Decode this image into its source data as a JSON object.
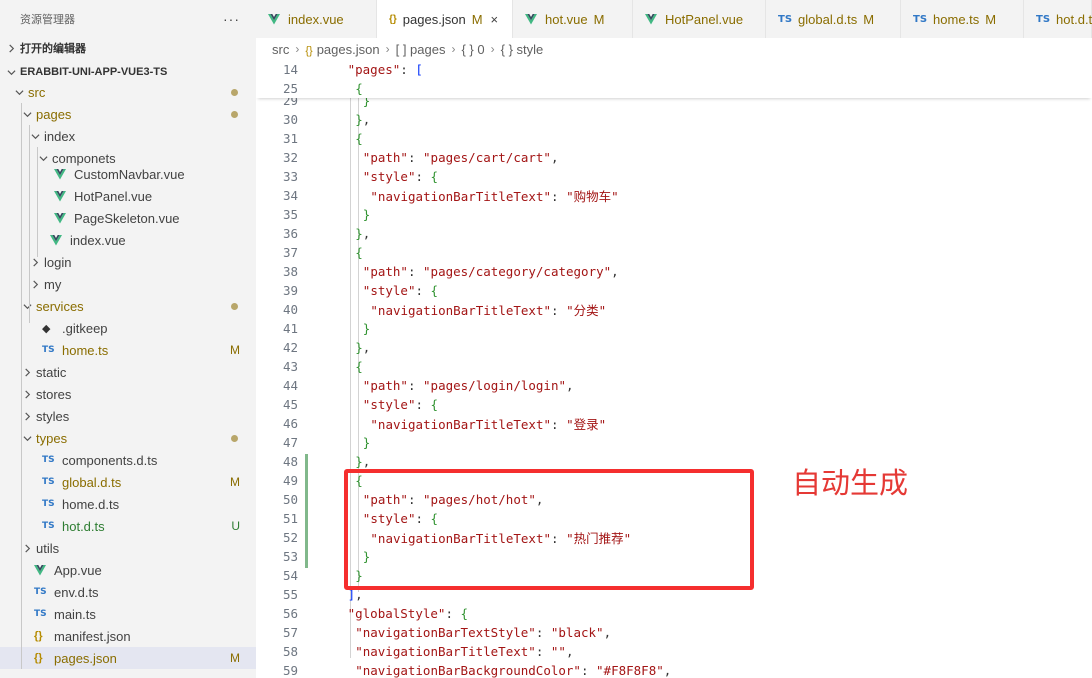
{
  "explorer": {
    "title": "资源管理器",
    "more": "···",
    "open_editors": "打开的编辑器",
    "project": "ERABBIT-UNI-APP-VUE3-TS",
    "rows": [
      {
        "label": "src",
        "kind": "folder",
        "open": true,
        "depth": 0,
        "status": "dot",
        "style": "folder-mod"
      },
      {
        "label": "pages",
        "kind": "folder",
        "open": true,
        "depth": 1,
        "status": "dot",
        "style": "folder-mod"
      },
      {
        "label": "index",
        "kind": "folder",
        "open": true,
        "depth": 2,
        "status": "",
        "style": ""
      },
      {
        "label": "componets",
        "kind": "folder",
        "open": true,
        "depth": 3,
        "status": "",
        "style": ""
      },
      {
        "label": "CustomNavbar.vue",
        "kind": "vue",
        "depth": 4,
        "status": "",
        "style": ""
      },
      {
        "label": "HotPanel.vue",
        "kind": "vue",
        "depth": 4,
        "status": "",
        "style": ""
      },
      {
        "label": "PageSkeleton.vue",
        "kind": "vue",
        "depth": 4,
        "status": "",
        "style": ""
      },
      {
        "label": "index.vue",
        "kind": "vue",
        "depth": 3,
        "status": "",
        "style": ""
      },
      {
        "label": "login",
        "kind": "folder",
        "open": false,
        "depth": 2,
        "status": "",
        "style": ""
      },
      {
        "label": "my",
        "kind": "folder",
        "open": false,
        "depth": 2,
        "status": "",
        "style": ""
      },
      {
        "label": "services",
        "kind": "folder",
        "open": true,
        "depth": 1,
        "status": "dot",
        "style": "folder-mod"
      },
      {
        "label": ".gitkeep",
        "kind": "git",
        "depth": 2,
        "status": "",
        "style": ""
      },
      {
        "label": "home.ts",
        "kind": "ts",
        "depth": 2,
        "status": "M",
        "style": "mod"
      },
      {
        "label": "static",
        "kind": "folder",
        "open": false,
        "depth": 1,
        "status": "",
        "style": ""
      },
      {
        "label": "stores",
        "kind": "folder",
        "open": false,
        "depth": 1,
        "status": "",
        "style": ""
      },
      {
        "label": "styles",
        "kind": "folder",
        "open": false,
        "depth": 1,
        "status": "",
        "style": ""
      },
      {
        "label": "types",
        "kind": "folder",
        "open": true,
        "depth": 1,
        "status": "dot",
        "style": "folder-mod"
      },
      {
        "label": "components.d.ts",
        "kind": "ts",
        "depth": 2,
        "status": "",
        "style": ""
      },
      {
        "label": "global.d.ts",
        "kind": "ts",
        "depth": 2,
        "status": "M",
        "style": "mod"
      },
      {
        "label": "home.d.ts",
        "kind": "ts",
        "depth": 2,
        "status": "",
        "style": ""
      },
      {
        "label": "hot.d.ts",
        "kind": "ts",
        "depth": 2,
        "status": "U",
        "style": "untracked"
      },
      {
        "label": "utils",
        "kind": "folder",
        "open": false,
        "depth": 1,
        "status": "",
        "style": ""
      },
      {
        "label": "App.vue",
        "kind": "vue",
        "depth": 1,
        "status": "",
        "style": ""
      },
      {
        "label": "env.d.ts",
        "kind": "ts",
        "depth": 1,
        "status": "",
        "style": ""
      },
      {
        "label": "main.ts",
        "kind": "ts",
        "depth": 1,
        "status": "",
        "style": ""
      },
      {
        "label": "manifest.json",
        "kind": "json",
        "depth": 1,
        "status": "",
        "style": ""
      },
      {
        "label": "pages.json",
        "kind": "json",
        "depth": 1,
        "status": "M",
        "style": "mod",
        "selected": true
      }
    ]
  },
  "tabs": [
    {
      "label": "index.vue",
      "icon": "vue",
      "status": "",
      "active": false
    },
    {
      "label": "pages.json",
      "icon": "json",
      "status": "M",
      "active": true
    },
    {
      "label": "hot.vue",
      "icon": "vue",
      "status": "M",
      "active": false
    },
    {
      "label": "HotPanel.vue",
      "icon": "vue",
      "status": "",
      "active": false
    },
    {
      "label": "global.d.ts",
      "icon": "ts",
      "status": "M",
      "active": false
    },
    {
      "label": "home.ts",
      "icon": "ts",
      "status": "M",
      "active": false
    },
    {
      "label": "hot.d.ts",
      "icon": "ts",
      "status": "",
      "active": false
    }
  ],
  "breadcrumb": [
    "src",
    "pages.json",
    "[ ] pages",
    "{ } 0",
    "{ } style"
  ],
  "icons": {
    "json": "{}",
    "ts": "TS",
    "close": "×",
    "chevron_right": "chevron-right-icon",
    "chevron_down": "chevron-down-icon"
  },
  "code": {
    "sticky": [
      {
        "n": "14",
        "text": "\"pages\": ["
      },
      {
        "n": "25",
        "text": "{"
      }
    ],
    "lines": [
      {
        "n": "29",
        "text": "}"
      },
      {
        "n": "30",
        "text": "},"
      },
      {
        "n": "31",
        "text": "{"
      },
      {
        "n": "32",
        "text": "\"path\": \"pages/cart/cart\","
      },
      {
        "n": "33",
        "text": "\"style\": {"
      },
      {
        "n": "34",
        "text": "\"navigationBarTitleText\": \"购物车\""
      },
      {
        "n": "35",
        "text": "}"
      },
      {
        "n": "36",
        "text": "},"
      },
      {
        "n": "37",
        "text": "{"
      },
      {
        "n": "38",
        "text": "\"path\": \"pages/category/category\","
      },
      {
        "n": "39",
        "text": "\"style\": {"
      },
      {
        "n": "40",
        "text": "\"navigationBarTitleText\": \"分类\""
      },
      {
        "n": "41",
        "text": "}"
      },
      {
        "n": "42",
        "text": "},"
      },
      {
        "n": "43",
        "text": "{"
      },
      {
        "n": "44",
        "text": "\"path\": \"pages/login/login\","
      },
      {
        "n": "45",
        "text": "\"style\": {"
      },
      {
        "n": "46",
        "text": "\"navigationBarTitleText\": \"登录\""
      },
      {
        "n": "47",
        "text": "}"
      },
      {
        "n": "48",
        "text": "},"
      },
      {
        "n": "49",
        "text": "{"
      },
      {
        "n": "50",
        "text": "\"path\": \"pages/hot/hot\","
      },
      {
        "n": "51",
        "text": "\"style\": {"
      },
      {
        "n": "52",
        "text": "\"navigationBarTitleText\": \"热门推荐\""
      },
      {
        "n": "53",
        "text": "}"
      },
      {
        "n": "54",
        "text": "}"
      },
      {
        "n": "55",
        "text": "],"
      },
      {
        "n": "56",
        "text": "\"globalStyle\": {"
      },
      {
        "n": "57",
        "text": "\"navigationBarTextStyle\": \"black\","
      },
      {
        "n": "58",
        "text": "\"navigationBarTitleText\": \"\","
      },
      {
        "n": "59",
        "text": "\"navigationBarBackgroundColor\": \"#F8F8F8\","
      }
    ]
  },
  "annotation": "自动生成",
  "colors": {
    "modified": "#8a6d00",
    "untracked": "#2e7d32",
    "highlight": "#f52e2e",
    "vue_green": "#41b883"
  }
}
